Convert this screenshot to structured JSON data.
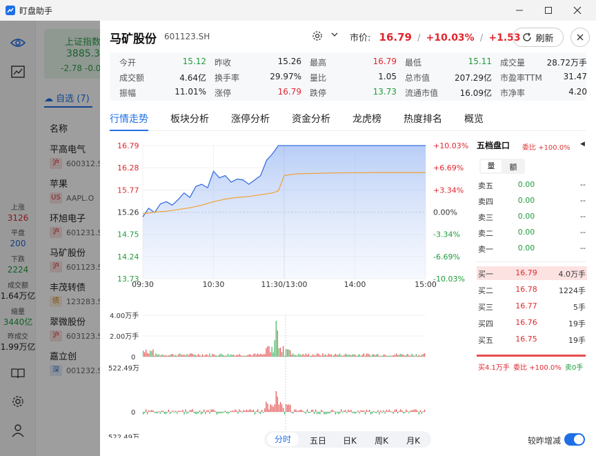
{
  "window": {
    "title": "盯盘助手"
  },
  "leftnav": {
    "stats": [
      {
        "label": "上涨",
        "value": "3126",
        "color": "#e0262c"
      },
      {
        "label": "平盘",
        "value": "200",
        "color": "#2b63c9"
      },
      {
        "label": "下跌",
        "value": "2224",
        "color": "#1e9b3b"
      },
      {
        "label": "成交额",
        "value": "1.64万亿",
        "color": "#222222"
      },
      {
        "label": "缩量",
        "value": "3440亿",
        "color": "#1e9b3b"
      },
      {
        "label": "昨成交",
        "value": "1.99万亿",
        "color": "#222222"
      }
    ]
  },
  "watchlist": {
    "index": {
      "name": "上证指数",
      "value": "3885.3",
      "change": "-2.78  -0.0"
    },
    "tab_label": "自选 (7)",
    "column_header": "名称",
    "items": [
      {
        "name": "平高电气",
        "market": "沪",
        "code": "600312.S",
        "mk": "hu"
      },
      {
        "name": "苹果",
        "market": "US",
        "code": "AAPL.O",
        "mk": "us"
      },
      {
        "name": "环旭电子",
        "market": "沪",
        "code": "601231.S",
        "mk": "hu"
      },
      {
        "name": "马矿股份",
        "market": "沪",
        "code": "601123.S",
        "mk": "hu"
      },
      {
        "name": "丰茂转债",
        "market": "债",
        "code": "123283.S",
        "mk": "zhai"
      },
      {
        "name": "翠微股份",
        "market": "沪",
        "code": "603123.S",
        "mk": "hu"
      },
      {
        "name": "嘉立创",
        "market": "深",
        "code": "001232.S",
        "mk": "shen"
      }
    ]
  },
  "stock": {
    "name": "马矿股份",
    "code": "601123.SH",
    "price_label": "市价:",
    "price": "16.79",
    "sep": "/",
    "pct": "+10.03%",
    "chg": "+1.53",
    "refresh_label": "刷新"
  },
  "quote": [
    [
      {
        "k": "今开",
        "v": "15.12",
        "c": "green"
      },
      {
        "k": "昨收",
        "v": "15.26",
        "c": "dark"
      },
      {
        "k": "最高",
        "v": "16.79",
        "c": "red"
      },
      {
        "k": "最低",
        "v": "15.11",
        "c": "green"
      },
      {
        "k": "成交量",
        "v": "28.72万手",
        "c": "dark"
      }
    ],
    [
      {
        "k": "成交额",
        "v": "4.64亿",
        "c": "dark"
      },
      {
        "k": "换手率",
        "v": "29.97%",
        "c": "dark"
      },
      {
        "k": "量比",
        "v": "1.05",
        "c": "dark"
      },
      {
        "k": "总市值",
        "v": "207.29亿",
        "c": "dark"
      },
      {
        "k": "市盈率TTM",
        "v": "31.47",
        "c": "dark"
      }
    ],
    [
      {
        "k": "振幅",
        "v": "11.01%",
        "c": "dark"
      },
      {
        "k": "涨停",
        "v": "16.79",
        "c": "red"
      },
      {
        "k": "跌停",
        "v": "13.73",
        "c": "green"
      },
      {
        "k": "流通市值",
        "v": "16.09亿",
        "c": "dark"
      },
      {
        "k": "市净率",
        "v": "4.20",
        "c": "dark"
      }
    ]
  ],
  "tabs": [
    "行情走势",
    "板块分析",
    "涨停分析",
    "资金分析",
    "龙虎榜",
    "热度排名",
    "概览"
  ],
  "chart_data": {
    "type": "line",
    "y_left_ticks": [
      "16.79",
      "16.28",
      "15.77",
      "15.26",
      "14.75",
      "14.24",
      "13.73"
    ],
    "y_right_ticks": [
      "+10.03%",
      "+6.69%",
      "+3.34%",
      "0.00%",
      "-3.34%",
      "-6.69%",
      "-10.03%"
    ],
    "x_ticks": [
      "09:30",
      "10:30",
      "11:30/13:00",
      "14:00",
      "15:00"
    ],
    "ylim": [
      13.73,
      16.79
    ],
    "series": [
      {
        "color": "#3a6fe0",
        "x": [
          0,
          5,
          10,
          15,
          20,
          25,
          30,
          35,
          40,
          45,
          50,
          55,
          60,
          65,
          70,
          75,
          80,
          85,
          90,
          95,
          100,
          105,
          110,
          115,
          120,
          121,
          130,
          240
        ],
        "values": [
          15.15,
          15.35,
          15.25,
          15.45,
          15.5,
          15.42,
          15.55,
          15.7,
          15.6,
          15.85,
          15.9,
          15.82,
          16.2,
          16.05,
          16.1,
          15.95,
          16.02,
          16.0,
          15.9,
          16.0,
          16.1,
          16.45,
          16.6,
          16.79,
          16.79,
          16.79,
          16.79,
          16.79
        ]
      },
      {
        "color": "#f0a030",
        "x": [
          0,
          10,
          20,
          30,
          40,
          50,
          60,
          70,
          80,
          90,
          100,
          110,
          115,
          120,
          130,
          160,
          200,
          240
        ],
        "values": [
          15.22,
          15.26,
          15.28,
          15.32,
          15.36,
          15.42,
          15.5,
          15.56,
          15.6,
          15.62,
          15.66,
          15.7,
          15.75,
          16.1,
          16.14,
          16.16,
          16.17,
          16.17
        ]
      }
    ],
    "volume_ticks": [
      "4.00万手",
      "2.00万手",
      "0"
    ],
    "flow_ticks": [
      "522.49万",
      "0",
      "522.49万"
    ]
  },
  "orderbook": {
    "title": "五档盘口",
    "ratio": "委比 +100.0%",
    "toggle": [
      "量",
      "额"
    ],
    "sells": [
      {
        "l": "卖五",
        "p": "0.00",
        "q": "--"
      },
      {
        "l": "卖四",
        "p": "0.00",
        "q": "--"
      },
      {
        "l": "卖三",
        "p": "0.00",
        "q": "--"
      },
      {
        "l": "卖二",
        "p": "0.00",
        "q": "--"
      },
      {
        "l": "卖一",
        "p": "0.00",
        "q": "--"
      }
    ],
    "buys": [
      {
        "l": "买一",
        "p": "16.79",
        "q": "4.0万手"
      },
      {
        "l": "买二",
        "p": "16.78",
        "q": "1224手"
      },
      {
        "l": "买三",
        "p": "16.77",
        "q": "5手"
      },
      {
        "l": "买四",
        "p": "16.76",
        "q": "19手"
      },
      {
        "l": "买五",
        "p": "16.75",
        "q": "19手"
      }
    ],
    "foot_buy": "买4.1万手",
    "foot_ratio": "委比 +100.0%",
    "foot_sell": "卖0手"
  },
  "period": [
    "分时",
    "五日",
    "日K",
    "周K",
    "月K"
  ],
  "toggle_label": "较昨增减",
  "colors": {
    "accent": "#1e6fe6",
    "up": "#e0262c",
    "down": "#1e9b3b"
  }
}
